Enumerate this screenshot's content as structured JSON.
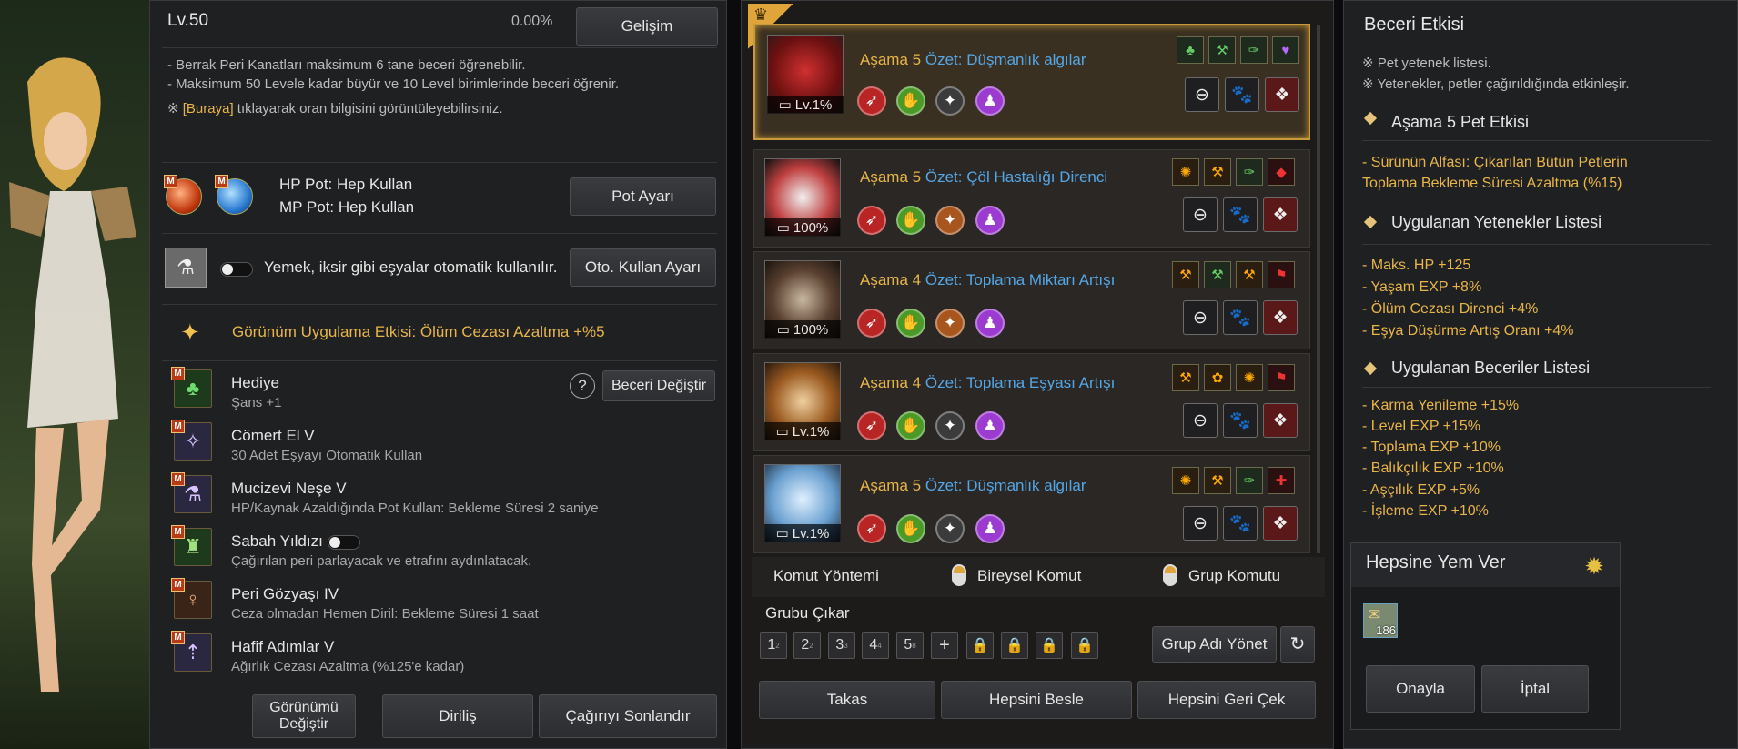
{
  "left": {
    "level": "Lv.50",
    "percent": "0.00%",
    "develop_btn": "Gelişim",
    "info": [
      "- Berrak Peri Kanatları maksimum 6 tane beceri öğrenebilir.",
      "- Maksimum 50 Levele kadar büyür ve 10 Level birimlerinde beceri öğrenir."
    ],
    "info3_prefix": "※ ",
    "info3_link": "[Buraya]",
    "info3_rest": " tıklayarak oran bilgisini görüntüleyebilirsiniz.",
    "hp_pot": "HP Pot: Hep Kullan",
    "mp_pot": "MP Pot: Hep Kullan",
    "pot_btn": "Pot Ayarı",
    "auto_text": "Yemek, iksir gibi eşyalar otomatik kullanılır.",
    "auto_btn": "Oto. Kullan Ayarı",
    "appearance_effect": "Görünüm Uygulama Etkisi: Ölüm Cezası Azaltma +%5",
    "help": "?",
    "change_skill_btn": "Beceri Değiştir",
    "skills": [
      {
        "name": "Hediye",
        "desc": "Şans +1",
        "icon": "clover-icon"
      },
      {
        "name": "Cömert El V",
        "desc": "30 Adet Eşyayı Otomatik Kullan",
        "icon": "fairy-icon"
      },
      {
        "name": "Mucizevi Neşe V",
        "desc": "HP/Kaynak Azaldığında Pot Kullan: Bekleme Süresi 2 saniye",
        "icon": "potion-icon"
      },
      {
        "name": "Sabah Yıldızı",
        "desc": "Çağırılan peri parlayacak ve etrafını aydınlatacak.",
        "icon": "lantern-icon"
      },
      {
        "name": "Peri Gözyaşı IV",
        "desc": "Ceza olmadan Hemen Diril: Bekleme Süresi 1 saat",
        "icon": "tear-icon"
      },
      {
        "name": "Hafif Adımlar V",
        "desc": "Ağırlık Cezası Azaltma (%125'e kadar)",
        "icon": "weight-icon"
      }
    ],
    "m_badge": "M",
    "btn_appearance": "Görünümü Değiştir",
    "btn_revive": "Diriliş",
    "btn_end": "Çağırıyı Sonlandır"
  },
  "pets": [
    {
      "stage_label": "Aşama",
      "stage": "5",
      "summary": "Özet: Düşmanlık algılar",
      "level": "Lv.1%",
      "img": "red-dragon"
    },
    {
      "stage_label": "Aşama",
      "stage": "5",
      "summary": "Özet: Çöl Hastalığı Direnci",
      "level": "100%",
      "img": "white-dog"
    },
    {
      "stage_label": "Aşama",
      "stage": "4",
      "summary": "Özet: Toplama Miktarı Artışı",
      "level": "100%",
      "img": "hedgehog"
    },
    {
      "stage_label": "Aşama",
      "stage": "4",
      "summary": "Özet: Toplama Eşyası Artışı",
      "level": "Lv.1%",
      "img": "squirrel"
    },
    {
      "stage_label": "Aşama",
      "stage": "5",
      "summary": "Özet: Düşmanlık algılar",
      "level": "Lv.1%",
      "img": "ice-dragon"
    }
  ],
  "middle": {
    "cmd_method": "Komut Yöntemi",
    "cmd_single": "Bireysel Komut",
    "cmd_group": "Grup Komutu",
    "group_out": "Grubu Çıkar",
    "groups": [
      "1",
      "2",
      "3",
      "4",
      "5"
    ],
    "group_sup": [
      "2",
      "2",
      "3",
      "4",
      "8"
    ],
    "plus": "+",
    "group_name_btn": "Grup Adı Yönet",
    "btn_trade": "Takas",
    "btn_feed_all": "Hepsini Besle",
    "btn_recall_all": "Hepsini Geri Çek"
  },
  "right": {
    "title": "Beceri Etkisi",
    "notes": [
      "※ Pet yetenek listesi.",
      "※ Yetenekler, petler çağırıldığında etkinleşir."
    ],
    "sec1": "Aşama 5 Pet Etkisi",
    "sec1_items": [
      "- Sürünün Alfası: Çıkarılan Bütün Petlerin",
      "Toplama Bekleme Süresi Azaltma (%15)"
    ],
    "sec2": "Uygulanan Yetenekler Listesi",
    "sec2_items": [
      "- Maks. HP +125",
      "- Yaşam EXP +8%",
      "- Ölüm Cezası Direnci +4%",
      "- Eşya Düşürme Artış Oranı +4%"
    ],
    "sec3": "Uygulanan Beceriler Listesi",
    "sec3_items": [
      "- Karma Yenileme +15%",
      "- Level EXP +15%",
      "- Toplama EXP +10%",
      "- Balıkçılık EXP +10%",
      "- Aşçılık EXP +5%",
      "- İşleme EXP +10%"
    ]
  },
  "feed": {
    "title": "Hepsine Yem Ver",
    "count": "186",
    "ok": "Onayla",
    "cancel": "İptal"
  }
}
